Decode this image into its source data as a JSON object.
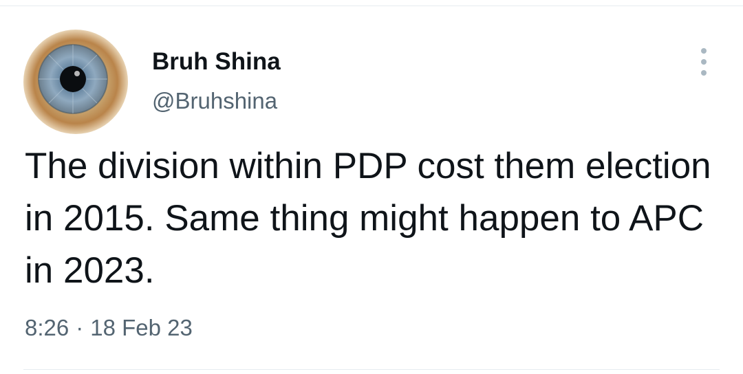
{
  "tweet": {
    "author": {
      "display_name": "Bruh Shina",
      "handle": "@Bruhshina",
      "avatar_icon": "eye-avatar-icon"
    },
    "more_icon": "more-options-icon",
    "text": "The division within PDP cost them election in 2015. Same thing might happen to APC in 2023.",
    "time": "8:26",
    "separator": "·",
    "date": "18 Feb 23"
  },
  "colors": {
    "text_primary": "#0f1419",
    "text_secondary": "#536471",
    "divider": "#e6ecf0",
    "more_dots": "#aab8c2"
  }
}
